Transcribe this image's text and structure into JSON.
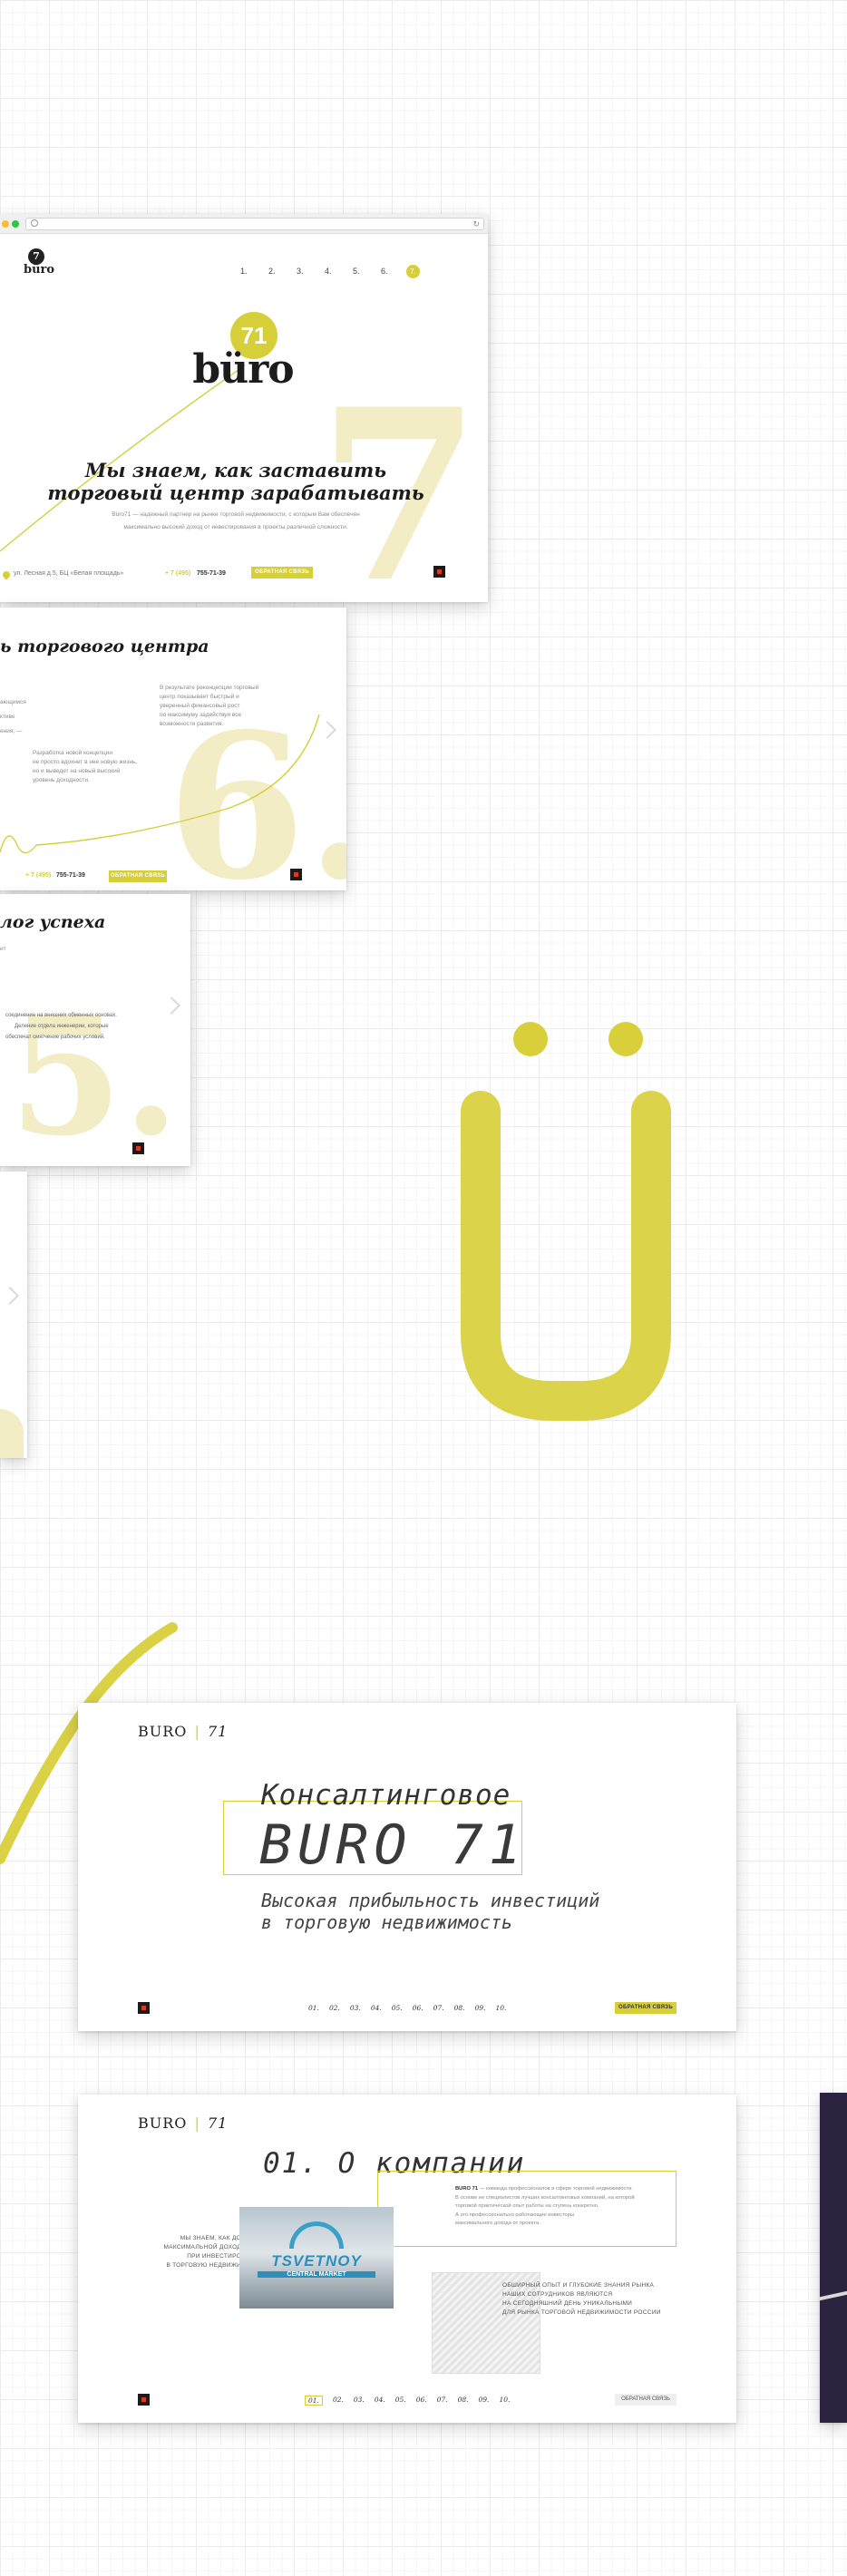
{
  "browser": {
    "dots": [
      "#ff5f57",
      "#ffbd2e",
      "#28c840"
    ]
  },
  "slide1": {
    "logo_top": "7",
    "logo_word": "büro",
    "nav": [
      "1.",
      "2.",
      "3.",
      "4.",
      "5.",
      "6.",
      "7."
    ],
    "hero_mark": "71",
    "hero_word": "büro",
    "heading_line1": "Мы знаем, как заставить",
    "heading_line2": "торговый центр зарабатывать",
    "desc_line1": "Büro71 — надежный партнер на рынке торговой недвижимости, с которым Вам обеспечен",
    "desc_line2": "максимально высокий доход от инвестирования в проекты различной сложности.",
    "big_digit": "7.",
    "address": "ул. Лесная д.5, БЦ «Белая площадь»",
    "phone_prefix": "+ 7 (495)",
    "phone": "755-71-39",
    "cta": "ОБРАТНАЯ СВЯЗЬ"
  },
  "slide2": {
    "heading": "ь торгового центра",
    "text_left_a": "ающимся",
    "text_left_b": "ктиве",
    "text_left_c": "ения, —",
    "text_right": [
      "В результате реконцепции торговый",
      "центр показывает быстрый и",
      "уверенный финансовый рост",
      "по максимуму задействуя все",
      "возможности развития."
    ],
    "text_mid": [
      "Разработка новой концепции",
      "не просто вдохнет в нее новую жизнь,",
      "но и выведет на новый высокий",
      "уровень доходности."
    ],
    "big_digit": "6.",
    "phone_prefix": "+ 7 (495)",
    "phone": "755-71-39",
    "cta": "ОБРАТНАЯ СВЯЗЬ"
  },
  "slide3": {
    "heading": "лог успеха",
    "text_a": "ит",
    "lines": [
      "соединение на внешних обменных основах.",
      "Деление отдела инженерии, которые",
      "обеспечат смягчение рабочих условий."
    ],
    "big_digit": "5."
  },
  "decor": {
    "umlaut": "Ü",
    "accent_color": "#d6cf3a"
  },
  "slide5": {
    "brand_left": "BURO",
    "brand_right": "71",
    "title_line1": "Консалтинговое",
    "title_big": "BURO 71",
    "subtitle_line1": "Высокая прибыльность инвестиций",
    "subtitle_line2": "в торговую недвижимость",
    "pages": [
      "01.",
      "02.",
      "03.",
      "04.",
      "05.",
      "06.",
      "07.",
      "08.",
      "09.",
      "10."
    ],
    "cta": "ОБРАТНАЯ СВЯЗЬ"
  },
  "slide6": {
    "brand_left": "BURO",
    "brand_right": "71",
    "title": "01. О компании",
    "intro_lines": [
      "МЫ ЗНАЕМ, КАК ДО",
      "МАКСИМАЛЬНОЙ ДОХОД",
      "ПРИ ИНВЕСТИРО",
      "В ТОРГОВУЮ НЕДВИЖИ"
    ],
    "box_title": "BURO 71",
    "box_lines": [
      "— команда профессионалов в сфере торговой недвижимости.",
      "В основе ее специалистов лучших консалтинговых компаний, на которой",
      "торговой практической опыт работы на ступень конкретно.",
      "А это профессионально работающие инвесторы",
      "максимального дохода от проекта."
    ],
    "sign_top": "TSVETNOY",
    "sign_bottom": "CENTRAL MARKET",
    "exp_lines": [
      "ОБШИРНЫЙ ОПЫТ И ГЛУБОКИЕ ЗНАНИЯ РЫНКА",
      "НАШИХ СОТРУДНИКОВ ЯВЛЯЮТСЯ",
      "НА СЕГОДНЯШНИЙ ДЕНЬ УНИКАЛЬНЫМИ",
      "ДЛЯ РЫНКА ТОРГОВОЙ НЕДВИЖИМОСТИ РОССИИ"
    ],
    "pages": [
      "01.",
      "02.",
      "03.",
      "04.",
      "05.",
      "06.",
      "07.",
      "08.",
      "09.",
      "10."
    ],
    "active_page": "01.",
    "cta": "ОБРАТНАЯ СВЯЗЬ"
  }
}
